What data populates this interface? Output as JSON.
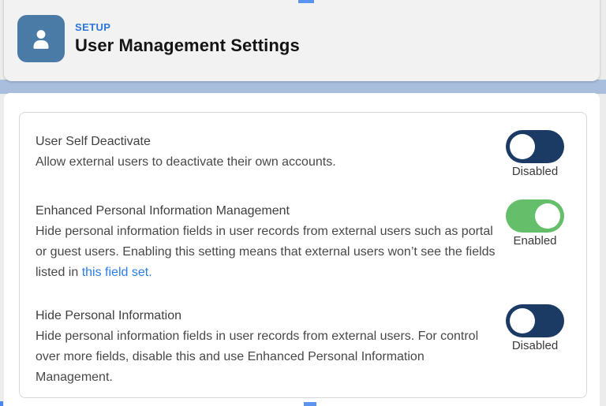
{
  "header": {
    "eyebrow": "SETUP",
    "title": "User Management Settings",
    "icon": "user-icon"
  },
  "settings": [
    {
      "label": "User Self Deactivate",
      "description": "Allow external users to deactivate their own accounts.",
      "state": "Disabled",
      "enabled": false
    },
    {
      "label": "Enhanced Personal Information Management",
      "description_before_link": "Hide personal information fields in user records from external users such as portal or guest users. Enabling this setting means that external users won’t see the fields listed in ",
      "link_text": "this field set.",
      "state": "Enabled",
      "enabled": true
    },
    {
      "label": "Hide Personal Information",
      "description": "Hide personal information fields in user records from external users. For control over more fields, disable this and use Enhanced Personal Information Management.",
      "state": "Disabled",
      "enabled": false
    }
  ],
  "colors": {
    "toggle_off": "#1b3a64",
    "toggle_on": "#65bf6a",
    "icon_background": "#4a7ba7",
    "eyebrow_blue": "#2b76d9",
    "link_blue": "#2b7de9",
    "band_blue": "#a9bedd"
  }
}
